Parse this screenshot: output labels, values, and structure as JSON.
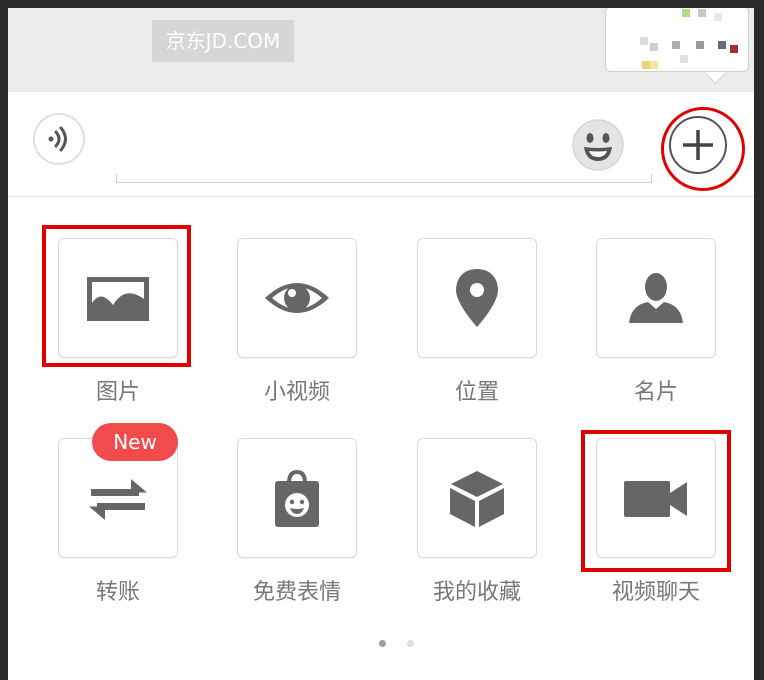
{
  "chat": {
    "banner_text": "京东JD.COM"
  },
  "input": {
    "voice_icon": "voice-wave-icon",
    "emoji_icon": "smiley-icon",
    "plus_icon": "plus-icon"
  },
  "panel": {
    "items": [
      {
        "label": "图片",
        "icon": "image-icon"
      },
      {
        "label": "小视频",
        "icon": "eye-icon"
      },
      {
        "label": "位置",
        "icon": "location-pin-icon"
      },
      {
        "label": "名片",
        "icon": "person-card-icon"
      },
      {
        "label": "转账",
        "icon": "transfer-arrows-icon",
        "badge": "New"
      },
      {
        "label": "免费表情",
        "icon": "sticker-bag-icon"
      },
      {
        "label": "我的收藏",
        "icon": "cube-icon"
      },
      {
        "label": "视频聊天",
        "icon": "video-camera-icon"
      }
    ],
    "page_count": 2,
    "active_page": 1
  },
  "colors": {
    "highlight": "#e00000",
    "badge": "#f24b4b",
    "icon_gray": "#666666",
    "label_gray": "#777777"
  }
}
